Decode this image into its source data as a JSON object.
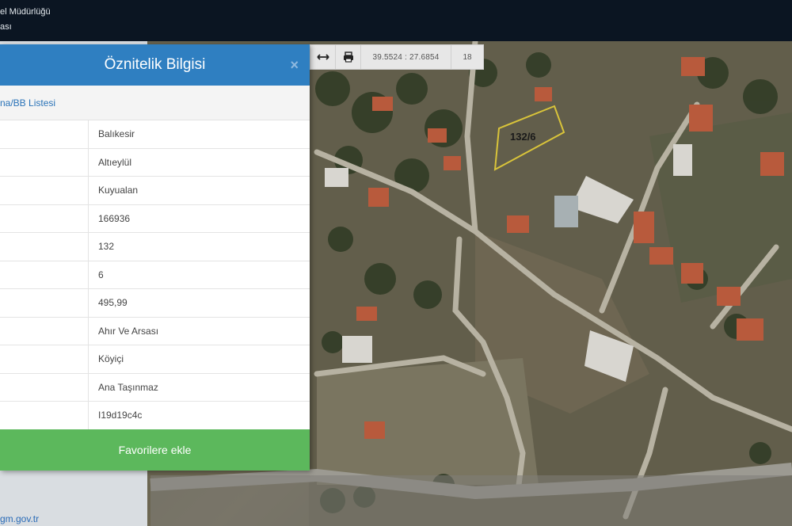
{
  "header": {
    "title_fragment": "el Müdürlüğü",
    "subtitle_fragment": "ası"
  },
  "map": {
    "parcel_label": "132/6",
    "toolbar": {
      "measure_icon": "measure-icon",
      "print_icon": "print-icon",
      "coordinates": "39.5524 : 27.6854",
      "zoom_level": "18"
    }
  },
  "panel": {
    "title": "Öznitelik Bilgisi",
    "close_label": "×",
    "subheader": "na/BB Listesi",
    "rows": [
      {
        "value": "Balıkesir"
      },
      {
        "value": "Altıeylül"
      },
      {
        "value": "Kuyualan"
      },
      {
        "value": "166936"
      },
      {
        "value": "132"
      },
      {
        "value": "6"
      },
      {
        "value": "495,99"
      },
      {
        "value": "Ahır Ve Arsası"
      },
      {
        "value": "Köyiçi"
      },
      {
        "value": "Ana Taşınmaz"
      },
      {
        "value": "I19d19c4c"
      }
    ],
    "favorite_button": "Favorilere ekle"
  },
  "footer": {
    "link": "gm.gov.tr"
  },
  "colors": {
    "panel_header": "#2f7fc1",
    "favorite_button": "#5cb85c",
    "topbar": "#0b1522"
  }
}
